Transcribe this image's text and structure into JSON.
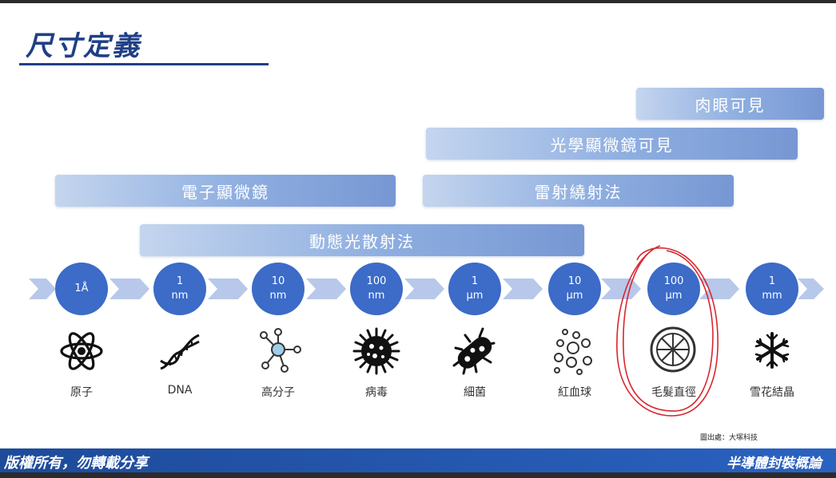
{
  "title": "尺寸定義",
  "ranges": {
    "naked_eye": "肉眼可見",
    "optical_microscope": "光學顯微鏡可見",
    "electron_microscope": "電子顯微鏡",
    "laser_diffraction": "雷射繞射法",
    "dynamic_light_scattering": "動態光散射法"
  },
  "scale": [
    {
      "value": "1Å",
      "unit": "",
      "label": "原子",
      "icon": "atom-icon"
    },
    {
      "value": "1",
      "unit": "nm",
      "label": "DNA",
      "icon": "dna-icon"
    },
    {
      "value": "10",
      "unit": "nm",
      "label": "高分子",
      "icon": "molecule-icon"
    },
    {
      "value": "100",
      "unit": "nm",
      "label": "病毒",
      "icon": "virus-icon"
    },
    {
      "value": "1",
      "unit": "µm",
      "label": "細菌",
      "icon": "bacteria-icon"
    },
    {
      "value": "10",
      "unit": "µm",
      "label": "紅血球",
      "icon": "red-blood-cells-icon"
    },
    {
      "value": "100",
      "unit": "µm",
      "label": "毛髮直徑",
      "icon": "hair-cross-section-icon"
    },
    {
      "value": "1",
      "unit": "mm",
      "label": "雪花結晶",
      "icon": "snowflake-icon"
    }
  ],
  "colors": {
    "accent": "#1f3f86",
    "scale_circle": "#3c6bc8",
    "annotation": "#d9262e",
    "footer": "#2458b0"
  },
  "source_note": "圖出處：大塚科技",
  "footer": {
    "left": "版權所有，勿轉載分享",
    "right": "半導體封裝概論"
  }
}
